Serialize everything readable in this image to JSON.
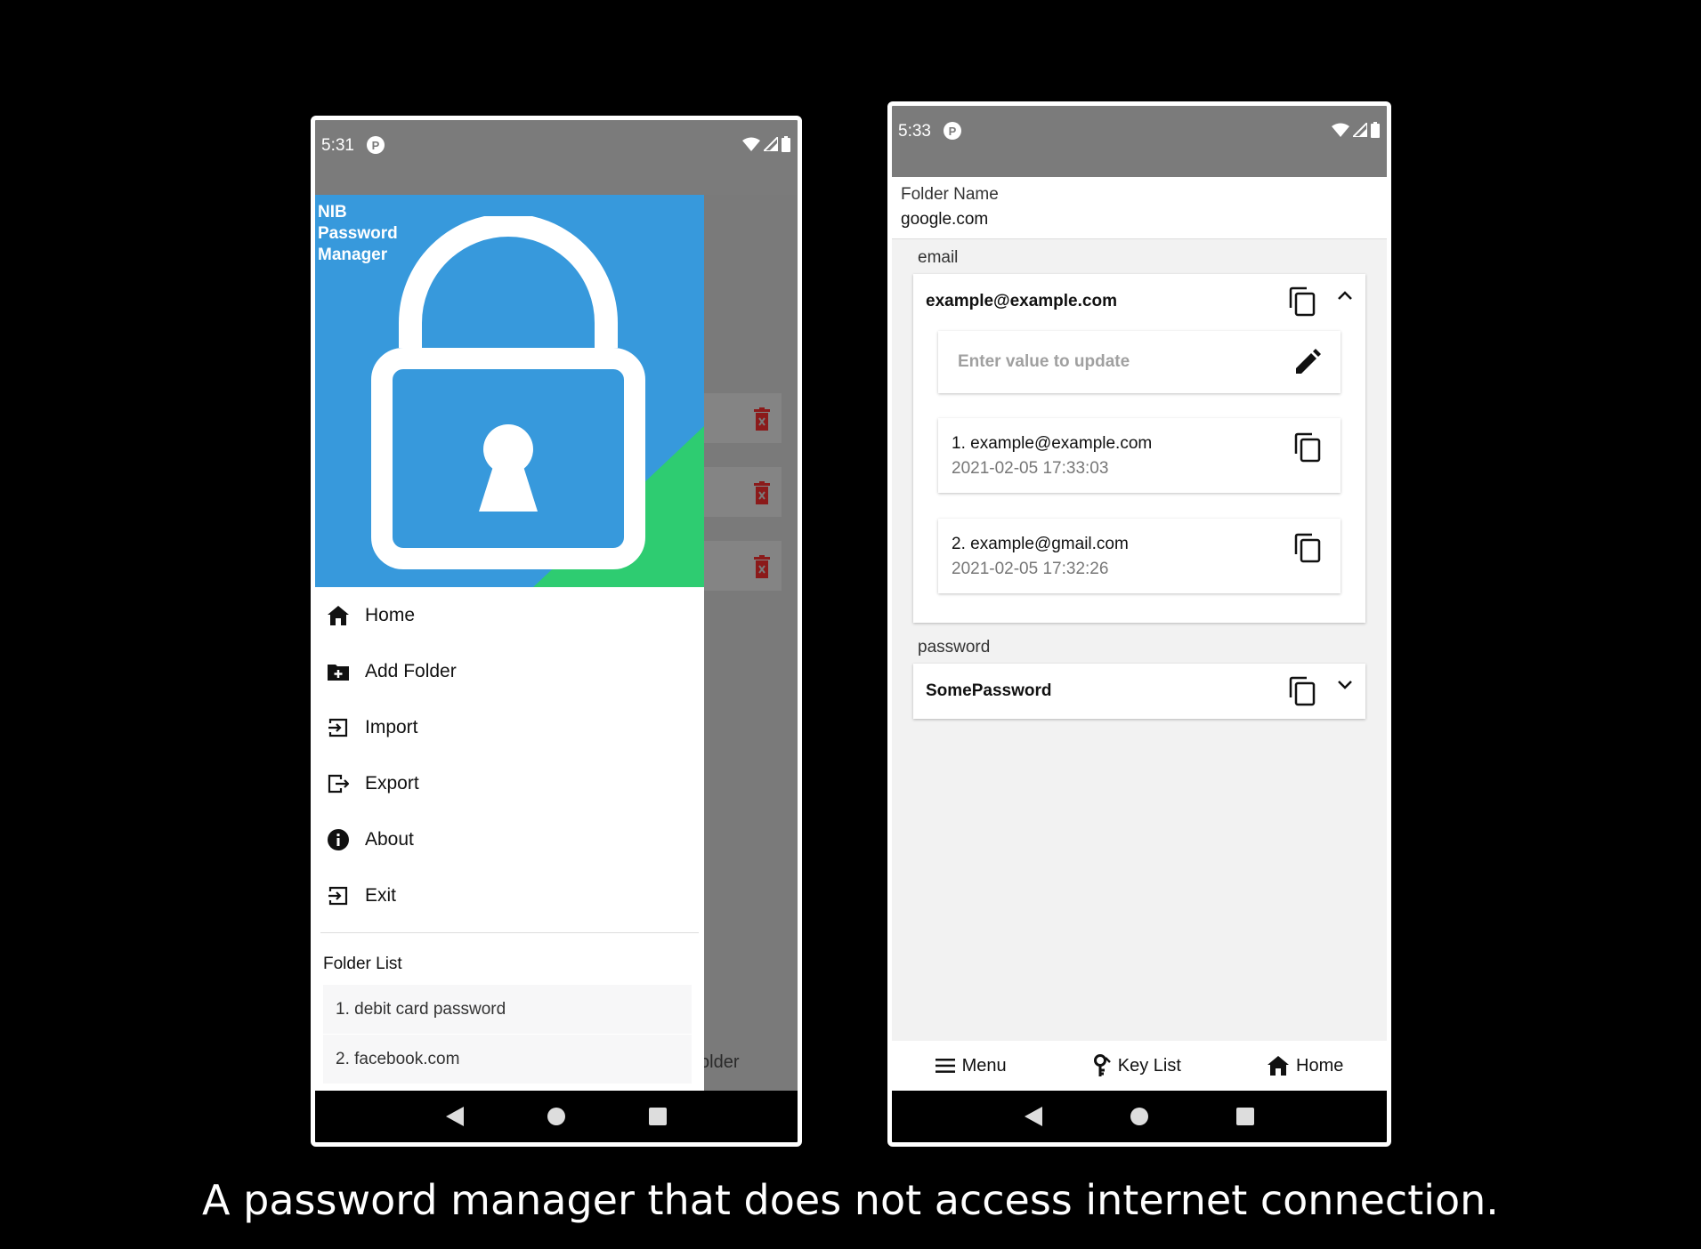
{
  "caption": "A password manager that does not access internet connection.",
  "left_phone": {
    "status": {
      "time": "5:31"
    },
    "drawer": {
      "title": "NIB Password Manager",
      "menu": [
        {
          "label": "Home",
          "icon": "home-icon"
        },
        {
          "label": "Add Folder",
          "icon": "add-folder-icon"
        },
        {
          "label": "Import",
          "icon": "import-icon"
        },
        {
          "label": "Export",
          "icon": "export-icon"
        },
        {
          "label": "About",
          "icon": "info-icon"
        },
        {
          "label": "Exit",
          "icon": "exit-icon"
        }
      ],
      "folder_list_label": "Folder List",
      "folders": [
        "1. debit card password",
        "2. facebook.com"
      ]
    },
    "background_partial_text": "older"
  },
  "right_phone": {
    "status": {
      "time": "5:33"
    },
    "folder_name_label": "Folder Name",
    "folder_name_value": "google.com",
    "fields": [
      {
        "label": "email",
        "value": "example@example.com",
        "expanded": true,
        "update_placeholder": "Enter value to update",
        "history": [
          {
            "value": "1. example@example.com",
            "time": "2021-02-05 17:33:03"
          },
          {
            "value": "2. example@gmail.com",
            "time": "2021-02-05 17:32:26"
          }
        ]
      },
      {
        "label": "password",
        "value": "SomePassword",
        "expanded": false
      }
    ],
    "tabs": [
      {
        "label": "Menu",
        "icon": "menu-icon"
      },
      {
        "label": "Key List",
        "icon": "key-icon"
      },
      {
        "label": "Home",
        "icon": "home-icon"
      }
    ]
  },
  "colors": {
    "header_blue": "#3799dc",
    "header_green": "#2ecc71",
    "delete_red": "#c0392b",
    "status_gray": "#7b7b7b"
  }
}
